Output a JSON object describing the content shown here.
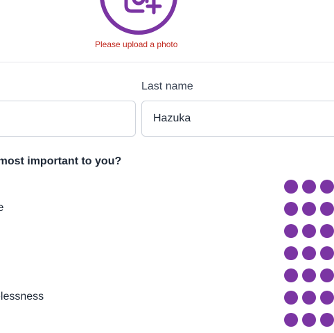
{
  "photo_upload": {
    "icon": "add-photo-icon",
    "accent_color": "#7b35a3",
    "error_text": "Please upload a photo",
    "error_color": "#c0281e"
  },
  "form": {
    "first_name": {
      "value": ""
    },
    "last_name": {
      "label": "Last name",
      "value": "Hazuka"
    }
  },
  "values_question": {
    "text": "ns are most important to you?",
    "rows": [
      {
        "label": ""
      },
      {
        "label": "fe"
      },
      {
        "label": ""
      },
      {
        "label": ""
      },
      {
        "label": ""
      },
      {
        "label": "elessness"
      },
      {
        "label": ""
      }
    ],
    "rating_color": "#7b35a3"
  }
}
